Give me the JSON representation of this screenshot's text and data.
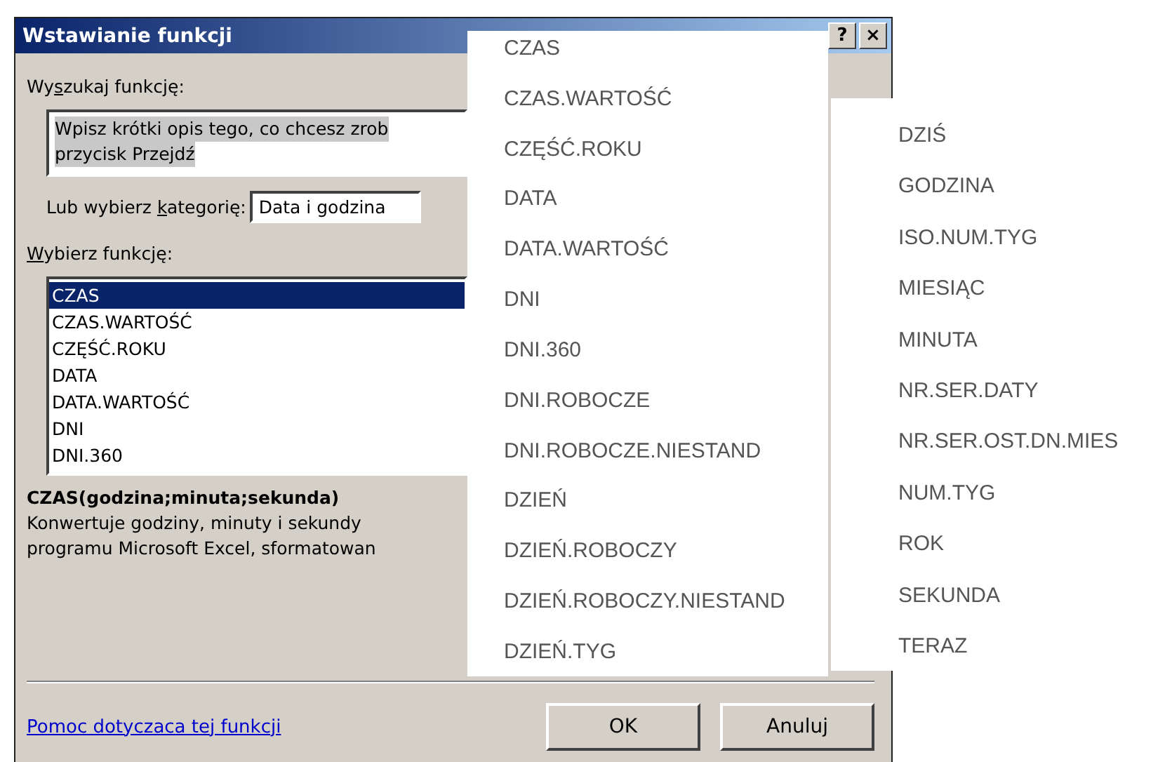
{
  "window": {
    "title": "Wstawianie funkcji",
    "title_buttons": [
      "?",
      "×"
    ]
  },
  "search": {
    "label_parts": [
      "Wy",
      "s",
      "zukaj funkcję:"
    ],
    "value_lines": [
      "Wpisz krótki opis tego, co chcesz zrob",
      "przycisk Przejdź"
    ]
  },
  "category": {
    "label_parts": [
      "Lub wybierz ",
      "k",
      "ategorię:"
    ],
    "value": "Data i godzina"
  },
  "functions": {
    "label_parts": [
      "W",
      "ybierz funkcję:"
    ],
    "items": [
      {
        "label": "CZAS",
        "selected": true
      },
      {
        "label": "CZAS.WARTOŚĆ",
        "selected": false
      },
      {
        "label": "CZĘŚĆ.ROKU",
        "selected": false
      },
      {
        "label": "DATA",
        "selected": false
      },
      {
        "label": "DATA.WARTOŚĆ",
        "selected": false
      },
      {
        "label": "DNI",
        "selected": false
      },
      {
        "label": "DNI.360",
        "selected": false
      }
    ]
  },
  "signature": "CZAS(godzina;minuta;sekunda)",
  "description_lines": [
    "Konwertuje godziny, minuty i sekundy",
    "programu Microsoft Excel, sformatowan"
  ],
  "help_link": "Pomoc dotyczaca tej funkcji",
  "buttons": [
    "OK",
    "Anuluj"
  ],
  "overlay_lists": [
    {
      "items": [
        "CZAS",
        "CZAS.WARTOŚĆ",
        "CZĘŚĆ.ROKU",
        "DATA",
        "DATA.WARTOŚĆ",
        "DNI",
        "DNI.360",
        "DNI.ROBOCZE",
        "DNI.ROBOCZE.NIESTAND",
        "DZIEŃ",
        "DZIEŃ.ROBOCZY",
        "DZIEŃ.ROBOCZY.NIESTAND",
        "DZIEŃ.TYG"
      ]
    },
    {
      "items": [
        "DZIŚ",
        "GODZINA",
        "ISO.NUM.TYG",
        "MIESIĄC",
        "MINUTA",
        "NR.SER.DATY",
        "NR.SER.OST.DN.MIES",
        "NUM.TYG",
        "ROK",
        "SEKUNDA",
        "TERAZ"
      ]
    }
  ]
}
